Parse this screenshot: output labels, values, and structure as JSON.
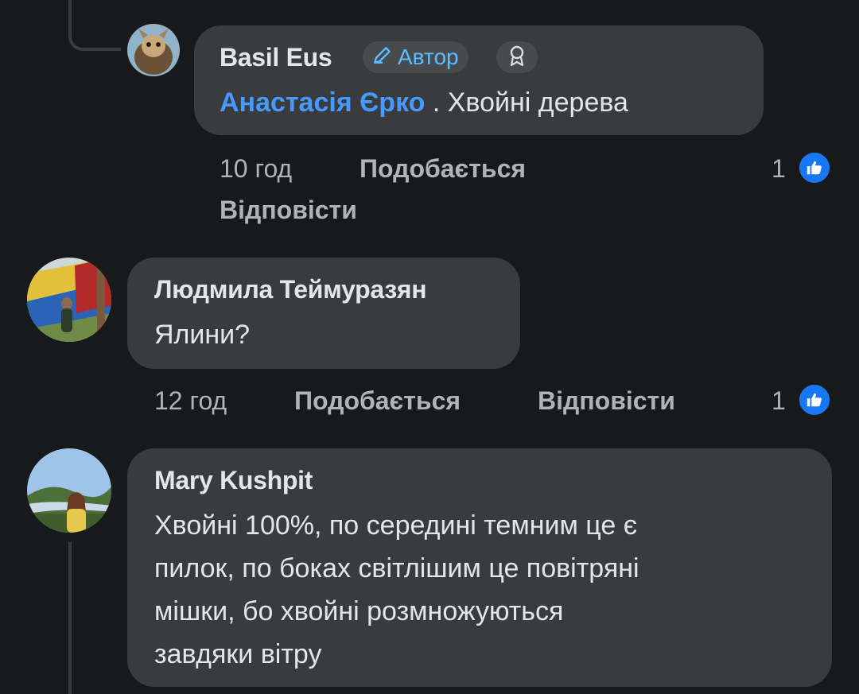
{
  "comments": [
    {
      "author": "Basil Eus",
      "badge_label": "Автор",
      "mention": "Анастасія Єрко",
      "text": " . Хвойні дерева",
      "time": "10 год",
      "like_label": "Подобається",
      "reply_label": "Відповісти",
      "reaction_count": "1"
    },
    {
      "author": "Людмила Теймуразян",
      "text": "Ялини?",
      "time": "12 год",
      "like_label": "Подобається",
      "reply_label": "Відповісти",
      "reaction_count": "1"
    },
    {
      "author": "Mary Kushpit",
      "text_lines": [
        "Хвойні 100%, по середині темним це є",
        "пилок, по боках світлішим це повітряні",
        "мішки, бо хвойні розмножуються",
        "завдяки вітру"
      ]
    }
  ],
  "colors": {
    "background": "#18191a",
    "bubble": "#3a3b3c",
    "accent": "#4599ff",
    "like_blue": "#1877f2"
  },
  "icons": {
    "author_badge": "pencil-icon",
    "award_badge": "award-icon",
    "reaction": "thumbs-up-icon"
  }
}
